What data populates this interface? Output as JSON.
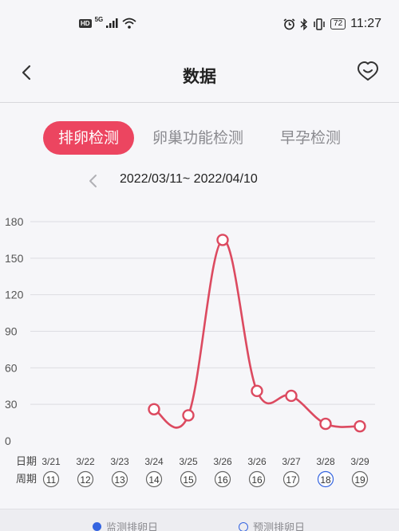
{
  "status_bar": {
    "hd": "HD",
    "signal": "5G",
    "battery": "72",
    "time": "11:27"
  },
  "header": {
    "title": "数据"
  },
  "tabs": [
    {
      "label": "排卵检测",
      "active": true
    },
    {
      "label": "卵巢功能检测",
      "active": false
    },
    {
      "label": "早孕检测",
      "active": false
    }
  ],
  "date_range": "2022/03/11~ 2022/04/10",
  "colors": {
    "accent": "#ec4560",
    "line": "#dc4a60",
    "legend_blue": "#3464e0"
  },
  "chart_data": {
    "type": "line",
    "title": "",
    "xlabel": "",
    "ylabel": "",
    "ylim": [
      0,
      180
    ],
    "y_ticks": [
      0,
      30,
      60,
      90,
      120,
      150,
      180
    ],
    "grid": true,
    "row_labels": {
      "date": "日期",
      "cycle": "周期"
    },
    "categories": [
      "3/21",
      "3/22",
      "3/23",
      "3/24",
      "3/25",
      "3/26",
      "3/26",
      "3/27",
      "3/28",
      "3/29"
    ],
    "cycle_days": [
      "11",
      "12",
      "13",
      "14",
      "15",
      "16",
      "16",
      "17",
      "18",
      "19"
    ],
    "predicted_days": [
      "18"
    ],
    "series": [
      {
        "values": [
          null,
          null,
          null,
          26,
          21,
          165,
          41,
          37,
          14,
          12
        ]
      }
    ]
  },
  "legend": {
    "monitored": "监测排卵日",
    "predicted": "预测排卵日"
  }
}
